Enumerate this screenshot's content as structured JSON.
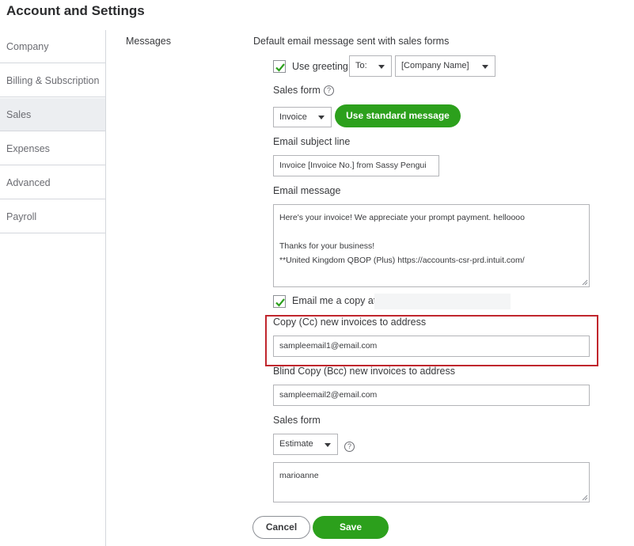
{
  "page": {
    "title": "Account and Settings"
  },
  "sidebar": {
    "items": [
      {
        "label": "Company"
      },
      {
        "label": "Billing & Subscription"
      },
      {
        "label": "Sales"
      },
      {
        "label": "Expenses"
      },
      {
        "label": "Advanced"
      },
      {
        "label": "Payroll"
      }
    ],
    "active": "Sales"
  },
  "messages": {
    "section_label": "Messages",
    "default_heading": "Default email message sent with sales forms",
    "use_greeting": {
      "label": "Use greeting",
      "checked": true
    },
    "greeting_to": {
      "value": "To:"
    },
    "greeting_name": {
      "value": "[Company Name]"
    },
    "sales_form_label": "Sales form",
    "sales_form_select": {
      "value": "Invoice"
    },
    "use_standard_button": "Use standard message",
    "email_subject_label": "Email subject line",
    "email_subject_value": "Invoice [Invoice No.] from Sassy Pengui",
    "email_message_label": "Email message",
    "email_message": {
      "line1": "Here's your invoice! We appreciate your prompt payment. helloooo",
      "line2": "Thanks for your business!",
      "line3": "**United Kingdom QBOP (Plus) https://accounts-csr-prd.intuit.com/"
    },
    "email_me_copy": {
      "label": "Email me a copy at",
      "checked": true
    },
    "cc_label": "Copy (Cc) new invoices to address",
    "cc_value": "sampleemail1@email.com",
    "bcc_label": "Blind Copy (Bcc) new invoices to address",
    "bcc_value": "sampleemail2@email.com",
    "sales_form2_label": "Sales form",
    "sales_form2_select": {
      "value": "Estimate"
    },
    "estimate_message": "marioanne"
  },
  "actions": {
    "cancel_label": "Cancel",
    "save_label": "Save"
  },
  "colors": {
    "accent": "#2ca01c",
    "highlight": "#c0262d",
    "active_tab_bg": "#eceef1"
  },
  "icons": {
    "check": "checkmark-icon",
    "help": "question-circle-icon",
    "caret": "caret-down-icon"
  }
}
